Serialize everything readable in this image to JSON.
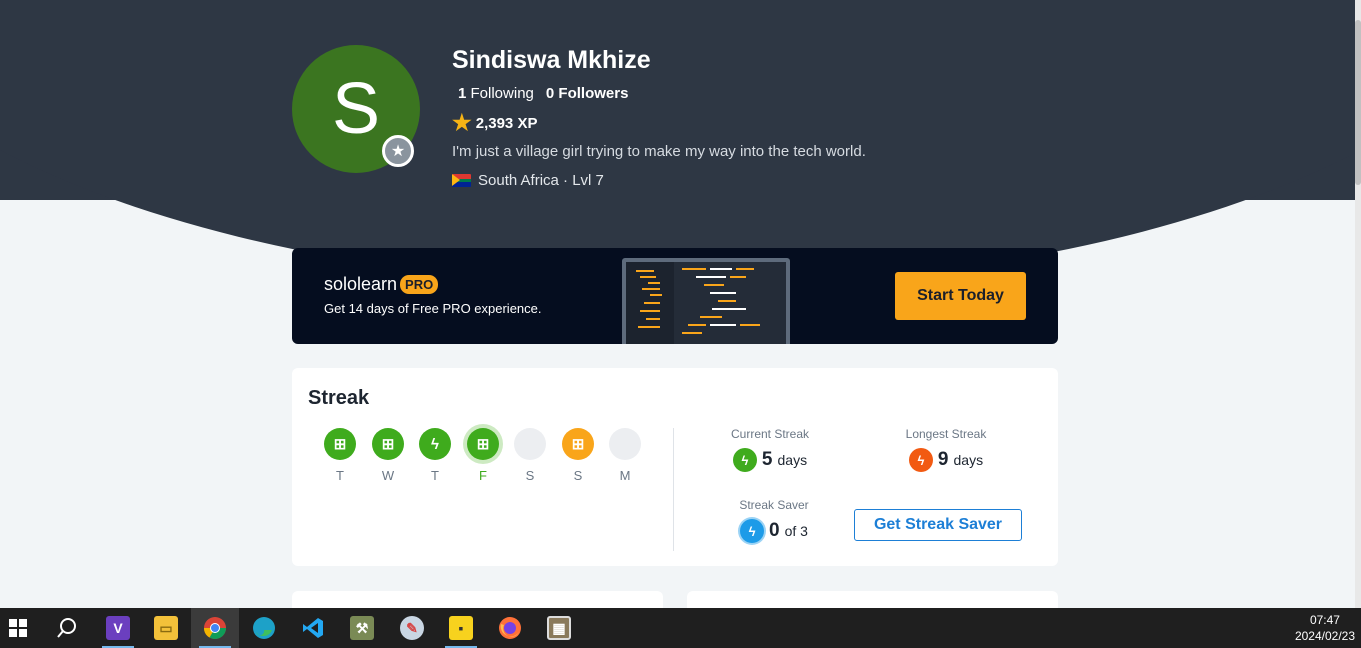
{
  "profile": {
    "avatar_letter": "S",
    "name": "Sindiswa Mkhize",
    "following_count": "1",
    "following_label": "Following",
    "followers_count": "0",
    "followers_label": "Followers",
    "xp": "2,393 XP",
    "bio": "I'm just a village girl trying to make my way into the tech world.",
    "country_level": "South Africa · Lvl 7"
  },
  "promo": {
    "brand": "sololearn",
    "badge": "PRO",
    "subtitle": "Get 14 days of Free PRO experience.",
    "cta": "Start Today"
  },
  "streak": {
    "title": "Streak",
    "days": [
      {
        "label": "T",
        "state": "gift"
      },
      {
        "label": "W",
        "state": "gift"
      },
      {
        "label": "T",
        "state": "bolt"
      },
      {
        "label": "F",
        "state": "today-gift"
      },
      {
        "label": "S",
        "state": "empty"
      },
      {
        "label": "S",
        "state": "gift-orange"
      },
      {
        "label": "M",
        "state": "empty"
      }
    ],
    "current_label": "Current Streak",
    "current_value": "5",
    "current_unit": "days",
    "longest_label": "Longest Streak",
    "longest_value": "9",
    "longest_unit": "days",
    "saver_label": "Streak Saver",
    "saver_value": "0",
    "saver_unit": "of 3",
    "saver_button": "Get Streak Saver"
  },
  "colors": {
    "header": "#2e3744",
    "accent_orange": "#f9a51a",
    "accent_green": "#3fab1d",
    "accent_blue": "#1d7fd6"
  },
  "taskbar": {
    "icons": [
      "windows-start-icon",
      "search-icon",
      "visual-studio-icon",
      "file-explorer-icon",
      "chrome-icon",
      "edge-icon",
      "vscode-icon",
      "tools-icon",
      "paint-icon",
      "sticky-notes-icon",
      "firefox-icon",
      "app-icon"
    ],
    "time": "07:47",
    "date": "2024/02/23"
  }
}
